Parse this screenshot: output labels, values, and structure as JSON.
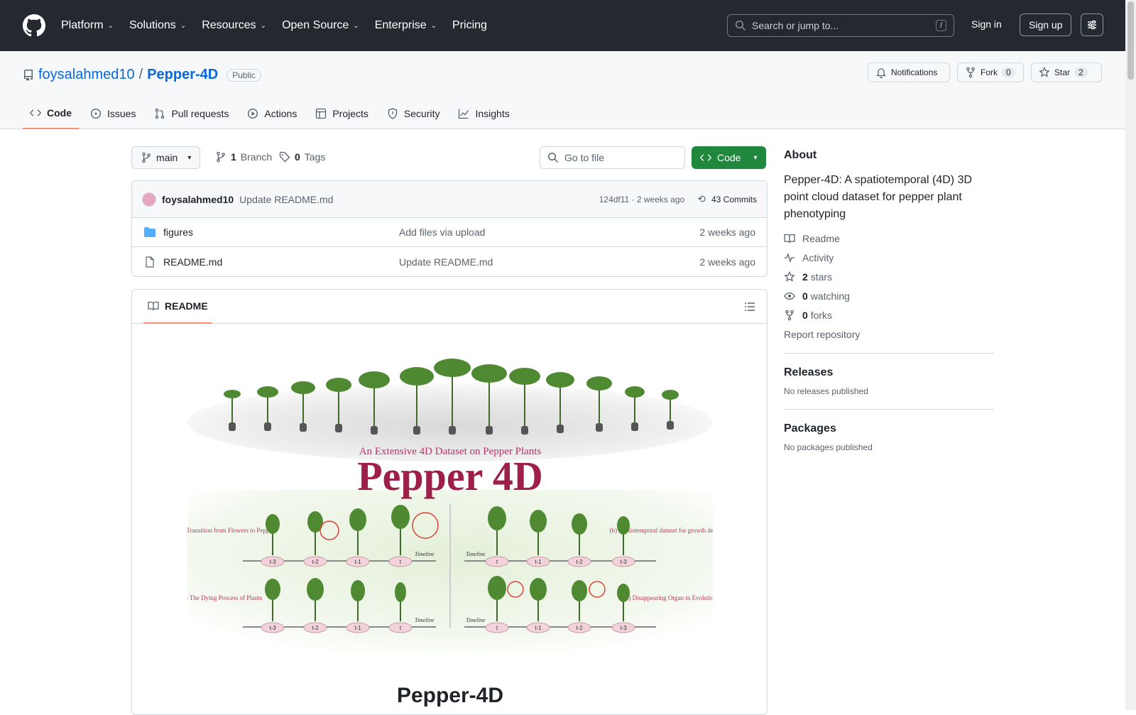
{
  "nav": {
    "items": [
      "Platform",
      "Solutions",
      "Resources",
      "Open Source",
      "Enterprise",
      "Pricing"
    ],
    "search_placeholder": "Search or jump to...",
    "search_key": "/",
    "signin": "Sign in",
    "signup": "Sign up"
  },
  "repo": {
    "owner": "foysalahmed10",
    "separator": "/",
    "name": "Pepper-4D",
    "visibility": "Public",
    "notifications": "Notifications",
    "fork_label": "Fork",
    "fork_count": "0",
    "star_label": "Star",
    "star_count": "2"
  },
  "tabs": [
    "Code",
    "Issues",
    "Pull requests",
    "Actions",
    "Projects",
    "Security",
    "Insights"
  ],
  "toolbar": {
    "branch": "main",
    "branch_count": "1",
    "branch_label": "Branch",
    "tag_count": "0",
    "tag_label": "Tags",
    "goto_placeholder": "Go to file",
    "code_label": "Code"
  },
  "commit": {
    "author": "foysalahmed10",
    "message": "Update README.md",
    "sha_time": "124df11 · 2 weeks ago",
    "commits": "43 Commits"
  },
  "files": [
    {
      "name": "figures",
      "type": "folder",
      "message": "Add files via upload",
      "time": "2 weeks ago"
    },
    {
      "name": "README.md",
      "type": "file",
      "message": "Update README.md",
      "time": "2 weeks ago"
    }
  ],
  "readme": {
    "tab": "README",
    "figure_subtitle": "An Extensive 4D Dataset on Pepper Plants",
    "figure_title": "Pepper 4D",
    "caption_a": "(a) The Transition from Flowers to Peppers",
    "caption_b": "(b) Spatiotemporal dataset for growth detection",
    "caption_c": "(c) The Dying Process of Plants",
    "caption_d": "(d) Disappearing Organ in Evolution",
    "timeline": "Timeline",
    "ticks_left": [
      "t-3",
      "t-2",
      "t-1",
      "t"
    ],
    "ticks_right": [
      "t",
      "t-1",
      "t-2",
      "t-3"
    ],
    "heading": "Pepper-4D"
  },
  "about": {
    "title": "About",
    "description": "Pepper-4D: A spatiotemporal (4D) 3D point cloud dataset for pepper plant phenotyping",
    "readme": "Readme",
    "activity": "Activity",
    "stars_n": "2",
    "stars": "stars",
    "watching_n": "0",
    "watching": "watching",
    "forks_n": "0",
    "forks": "forks",
    "report": "Report repository"
  },
  "releases": {
    "title": "Releases",
    "empty": "No releases published"
  },
  "packages": {
    "title": "Packages",
    "empty": "No packages published"
  },
  "colors": {
    "accent": "#0969da",
    "green": "#1f883d",
    "header": "#24292f",
    "tab_underline": "#fd8c73"
  }
}
